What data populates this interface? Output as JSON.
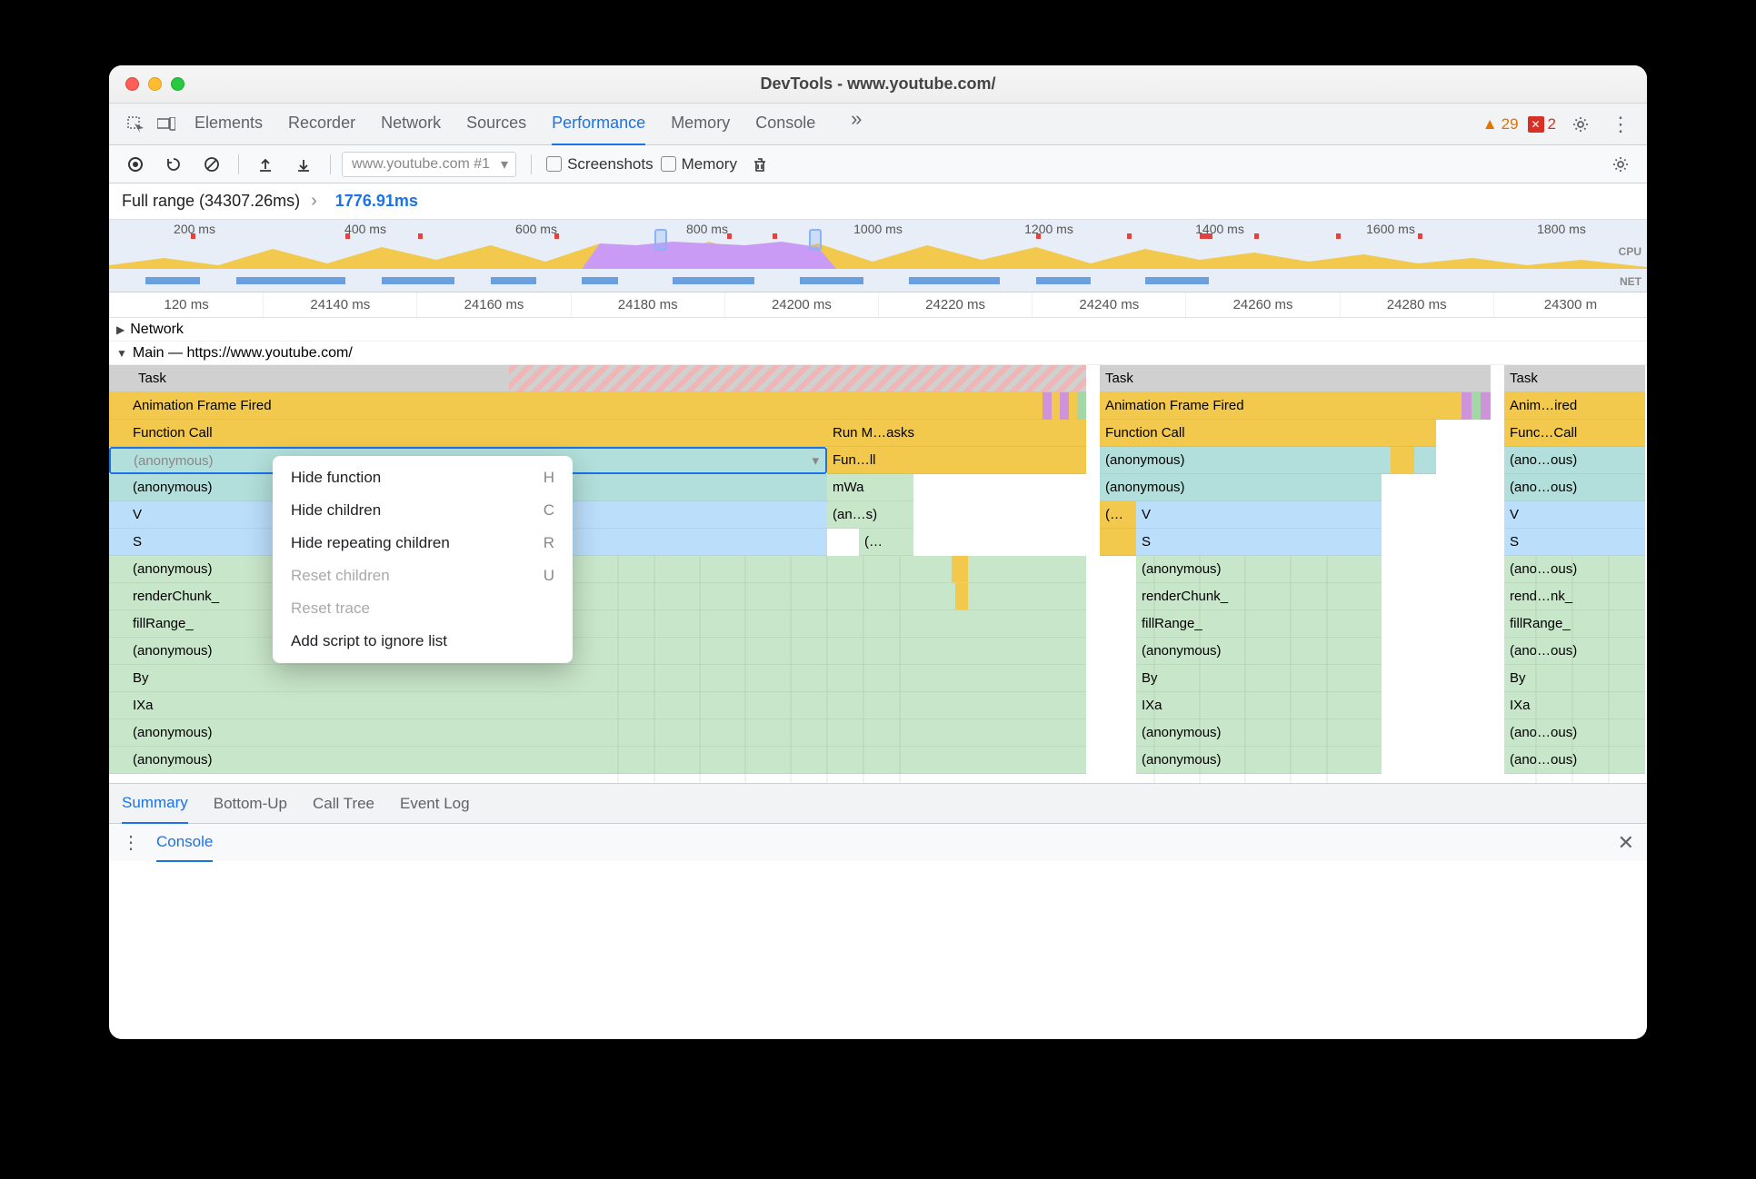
{
  "window_title": "DevTools - www.youtube.com/",
  "tabs": [
    "Elements",
    "Recorder",
    "Network",
    "Sources",
    "Performance",
    "Memory",
    "Console"
  ],
  "active_tab": "Performance",
  "warning_count": "29",
  "error_count": "2",
  "profile_selector": "www.youtube.com #1",
  "chk_screenshots": "Screenshots",
  "chk_memory": "Memory",
  "breadcrumb_full": "Full range (34307.26ms)",
  "breadcrumb_cur": "1776.91ms",
  "overview_ticks": [
    "200 ms",
    "400 ms",
    "600 ms",
    "800 ms",
    "1000 ms",
    "1200 ms",
    "1400 ms",
    "1600 ms",
    "1800 ms"
  ],
  "ruler_ticks": [
    "120 ms",
    "24140 ms",
    "24160 ms",
    "24180 ms",
    "24200 ms",
    "24220 ms",
    "24240 ms",
    "24260 ms",
    "24280 ms",
    "24300 m"
  ],
  "section_network": "Network",
  "section_main": "Main — https://www.youtube.com/",
  "cols": {
    "a": {
      "task": "Task",
      "aff": "Animation Frame Fired",
      "fc": "Function Call",
      "rmask": "Run M…asks",
      "anon1": "(anonymous)",
      "funll": "Fun…ll",
      "anon2": "(anonymous)",
      "mwa": "mWa",
      "v": "V",
      "ans": "(an…s)",
      "s": "S",
      "dots": "(…",
      "anon3": "(anonymous)",
      "rc": "renderChunk_",
      "fr": "fillRange_",
      "anon4": "(anonymous)",
      "by": "By",
      "ixa": "IXa",
      "anon5": "(anonymous)",
      "anon6": "(anonymous)"
    },
    "b": {
      "task": "Task",
      "aff": "Animation Frame Fired",
      "fc": "Function Call",
      "anon1": "(anonymous)",
      "anon2": "(anonymous)",
      "el": "(…",
      "v": "V",
      "s": "S",
      "anon3": "(anonymous)",
      "rc": "renderChunk_",
      "fr": "fillRange_",
      "anon4": "(anonymous)",
      "by": "By",
      "ixa": "IXa",
      "anon5": "(anonymous)",
      "anon6": "(anonymous)"
    },
    "c": {
      "task": "Task",
      "aff": "Anim…ired",
      "fc": "Func…Call",
      "anon1": "(ano…ous)",
      "anon2": "(ano…ous)",
      "v": "V",
      "s": "S",
      "anon3": "(ano…ous)",
      "rc": "rend…nk_",
      "fr": "fillRange_",
      "anon4": "(ano…ous)",
      "by": "By",
      "ixa": "IXa",
      "anon5": "(ano…ous)",
      "anon6": "(ano…ous)"
    }
  },
  "ctx": {
    "hide_fn": "Hide function",
    "hide_fn_sc": "H",
    "hide_ch": "Hide children",
    "hide_ch_sc": "C",
    "hide_rep": "Hide repeating children",
    "hide_rep_sc": "R",
    "reset_ch": "Reset children",
    "reset_ch_sc": "U",
    "reset_tr": "Reset trace",
    "ignore": "Add script to ignore list"
  },
  "detail_tabs": [
    "Summary",
    "Bottom-Up",
    "Call Tree",
    "Event Log"
  ],
  "console_label": "Console",
  "ov_cpu": "CPU",
  "ov_net": "NET"
}
